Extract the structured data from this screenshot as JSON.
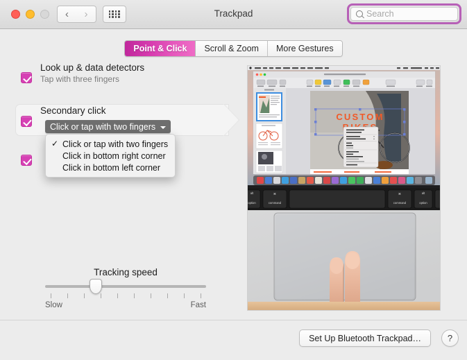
{
  "window": {
    "title": "Trackpad",
    "traffic_lights": [
      "close",
      "minimize",
      "zoom"
    ]
  },
  "toolbar": {
    "back_icon": "chevron-left-icon",
    "forward_icon": "chevron-right-icon",
    "grid_icon": "grid-icon",
    "search": {
      "placeholder": "Search",
      "value": "",
      "icon": "search-icon",
      "focused": true,
      "focus_ring_color": "#b760b7"
    }
  },
  "tabs": [
    {
      "label": "Point & Click",
      "selected": true
    },
    {
      "label": "Scroll & Zoom",
      "selected": false
    },
    {
      "label": "More Gestures",
      "selected": false
    }
  ],
  "options": [
    {
      "title": "Look up & data detectors",
      "subtitle": "Tap with three fingers",
      "checked": true
    },
    {
      "title": "Secondary click",
      "subtitle": "",
      "checked": true,
      "highlighted": true,
      "popup_value": "Click or tap with two fingers",
      "popup_open": true,
      "popup_options": [
        {
          "label": "Click or tap with two fingers",
          "checked": true
        },
        {
          "label": "Click in bottom right corner",
          "checked": false
        },
        {
          "label": "Click in bottom left corner",
          "checked": false
        }
      ]
    },
    {
      "title": "",
      "subtitle": "",
      "checked": true
    }
  ],
  "slider": {
    "label": "Tracking speed",
    "min_label": "Slow",
    "max_label": "Fast",
    "tick_count": 10,
    "value_percent": 30
  },
  "footer": {
    "setup_button": "Set Up Bluetooth Trackpad…",
    "help_button": "?"
  },
  "preview": {
    "description": "Video demo of a MacBook trackpad with two fingers performing a secondary click, above a Mac screen showing a Pages document",
    "screen_document_line1": "CUSTOM",
    "screen_document_line2": "BIKES",
    "keycap_left_outer": "option",
    "keycap_left_inner": "command",
    "keycap_right_inner": "command",
    "keycap_right_outer": "option"
  },
  "colors": {
    "accent": "#d641b4",
    "tab_selected_start": "#c0289c",
    "tab_selected_end": "#ef6cc6",
    "search_focus": "#b760b7",
    "window_bg": "#ececec"
  }
}
